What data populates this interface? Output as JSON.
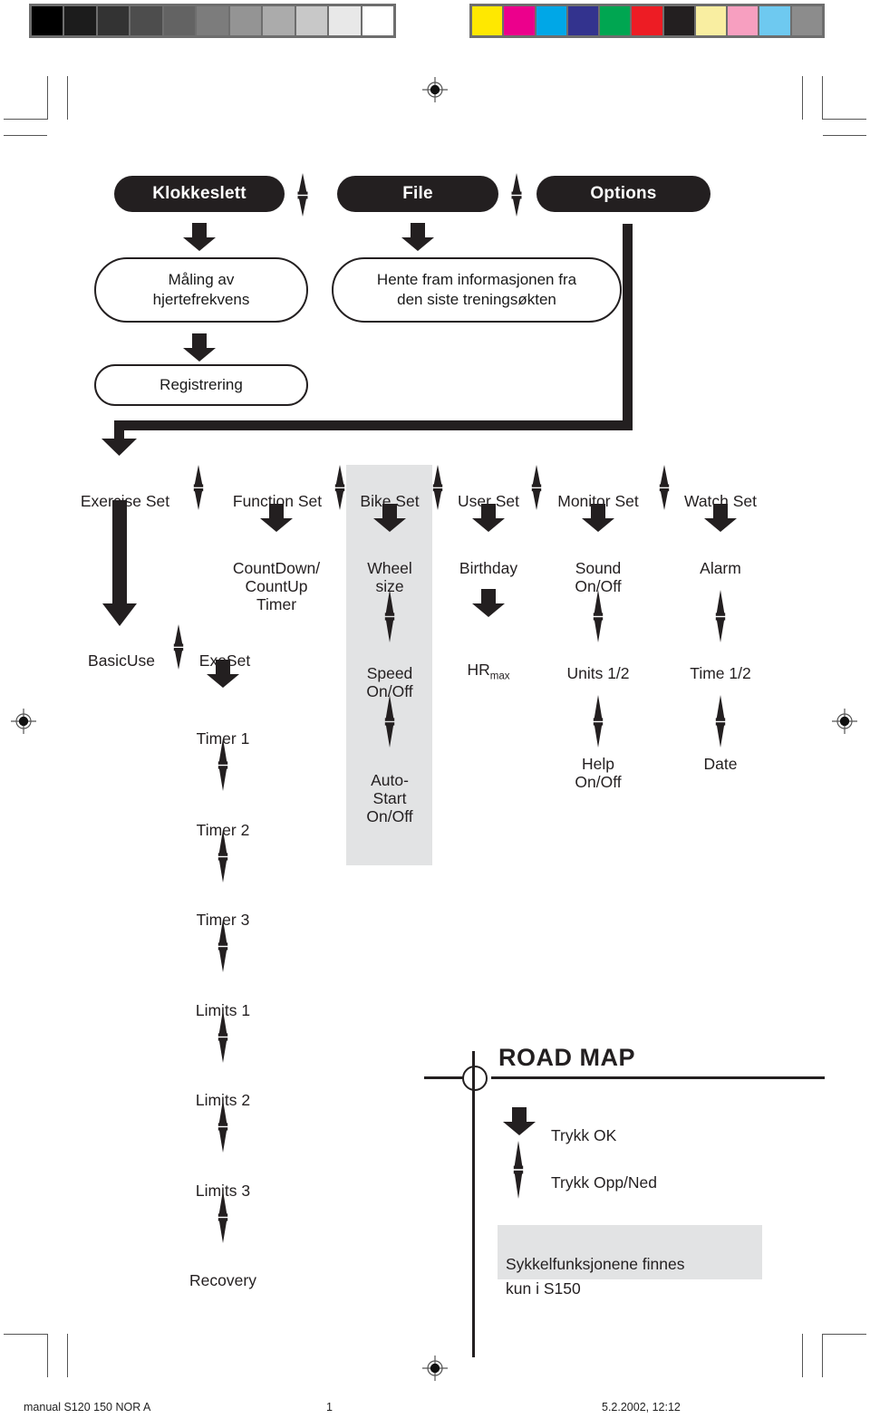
{
  "page": {
    "title": "ROAD MAP",
    "language": "Norwegian"
  },
  "calibration": {
    "grayscale_label": "grayscale-step-wedge",
    "grayscale": [
      "#000000",
      "#1c1c1c",
      "#333333",
      "#4d4d4d",
      "#636363",
      "#7c7c7c",
      "#949494",
      "#ababab",
      "#c8c8c8",
      "#e8e8e8",
      "#ffffff"
    ],
    "color_label": "color-control-patches",
    "colors": [
      "#ffe800",
      "#ec008c",
      "#00a7e7",
      "#33338e",
      "#00a651",
      "#ed1c24",
      "#231f20",
      "#f9eea1",
      "#f79fc0",
      "#6ec9f0",
      "#8c8c8c"
    ]
  },
  "menu_bar": {
    "items": [
      {
        "label": "Klokkeslett"
      },
      {
        "label": "File"
      },
      {
        "label": "Options"
      }
    ]
  },
  "descriptions": [
    {
      "label": "Måling av\nhjertefrekvens"
    },
    {
      "label": "Hente fram informasjonen fra\nden siste treningsøkten"
    },
    {
      "label": "Registrering"
    }
  ],
  "set_row": {
    "items": [
      {
        "label": "Exercise Set"
      },
      {
        "label": "Function Set"
      },
      {
        "label": "Bike Set"
      },
      {
        "label": "User Set"
      },
      {
        "label": "Monitor Set"
      },
      {
        "label": "Watch Set"
      }
    ]
  },
  "columns": {
    "exercise": [
      {
        "label": "BasicUse"
      },
      {
        "label": "ExeSet"
      },
      {
        "label": "Timer 1"
      },
      {
        "label": "Timer 2"
      },
      {
        "label": "Timer 3"
      },
      {
        "label": "Limits 1"
      },
      {
        "label": "Limits 2"
      },
      {
        "label": "Limits 3"
      },
      {
        "label": "Recovery"
      }
    ],
    "function": [
      {
        "label": "CountDown/\nCountUp\nTimer"
      }
    ],
    "bike": [
      {
        "label": "Wheel\nsize"
      },
      {
        "label": "Speed\nOn/Off"
      },
      {
        "label": "Auto-\nStart\nOn/Off"
      }
    ],
    "user": [
      {
        "label": "Birthday"
      },
      {
        "label": "HR",
        "sub": "max"
      }
    ],
    "monitor": [
      {
        "label": "Sound\nOn/Off"
      },
      {
        "label": "Units 1/2"
      },
      {
        "label": "Help\nOn/Off"
      }
    ],
    "watch": [
      {
        "label": "Alarm"
      },
      {
        "label": "Time 1/2"
      },
      {
        "label": "Date"
      }
    ]
  },
  "legend": {
    "title": "ROAD MAP",
    "entries": [
      {
        "icon": "thick-down-arrow-icon",
        "label": "Trykk OK"
      },
      {
        "icon": "up-down-arrow-icon",
        "label": "Trykk Opp/Ned"
      }
    ],
    "note": "Sykkelfunksjonene finnes\nkun i S150"
  },
  "footer": {
    "left": "manual S120 150 NOR A",
    "center": "1",
    "right": "5.2.2002, 12:12"
  }
}
